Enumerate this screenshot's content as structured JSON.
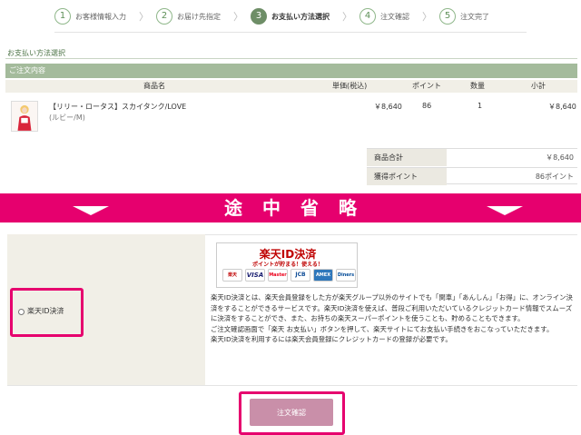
{
  "steps": [
    {
      "num": "1",
      "label": "お客様情報入力"
    },
    {
      "num": "2",
      "label": "お届け先指定"
    },
    {
      "num": "3",
      "label": "お支払い方法選択"
    },
    {
      "num": "4",
      "label": "注文確認"
    },
    {
      "num": "5",
      "label": "注文完了"
    }
  ],
  "chevron": "〉",
  "section_title": "お支払い方法選択",
  "order": {
    "header": "ご注文内容",
    "columns": {
      "product": "商品名",
      "price": "単価(税込)",
      "points": "ポイント",
      "qty": "数量",
      "subtotal": "小計"
    },
    "item": {
      "name": "【リリー・ロータス】スカイタンク/LOVE",
      "variant": "(ルビー/M)",
      "price": "￥8,640",
      "points": "86",
      "qty": "1",
      "subtotal": "￥8,640"
    },
    "summary": {
      "total_label": "商品合計",
      "total_value": "￥8,640",
      "points_label": "獲得ポイント",
      "points_value": "86ポイント"
    }
  },
  "omitted_banner": "途中省略",
  "payment": {
    "option_label": "楽天ID決済",
    "logo_title": "楽天ID決済",
    "logo_subtitle": "ポイントが貯まる！使える！",
    "card_brands": [
      "楽天",
      "VISA",
      "Master",
      "JCB",
      "AMEX",
      "Diners"
    ],
    "description": [
      "楽天ID決済とは、楽天会員登録をした方が楽天グループ以外のサイトでも「関車」「あんしん」「お得」に、オンライン決済をすることができるサービスです。楽天ID決済を使えば、普段ご利用いただいているクレジットカード情報でスムーズに決済をすることができ、また、お持ちの楽天スーパーポイントを使うことも、貯めることもできます。",
      "ご注文確認画面で「楽天 お支払い」ボタンを押して、楽天サイトにてお支払い手続きをおこなっていただきます。",
      "楽天ID決済を利用するには楽天会員登録にクレジットカードの登録が必要です。"
    ]
  },
  "submit_label": "注文確認",
  "colors": {
    "accent": "#e6006e",
    "green": "#a4bb9c",
    "button": "#c98fa9"
  }
}
